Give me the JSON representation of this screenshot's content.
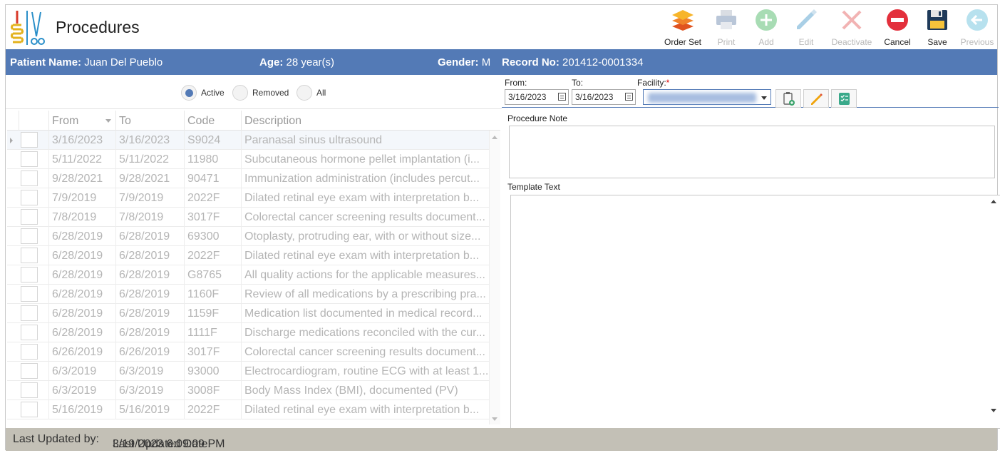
{
  "app": {
    "title": "Procedures"
  },
  "toolbar": {
    "order_set": "Order Set",
    "print": "Print",
    "add": "Add",
    "edit": "Edit",
    "deactivate": "Deactivate",
    "cancel": "Cancel",
    "save": "Save",
    "previous": "Previous"
  },
  "patient": {
    "name_label": "Patient Name:",
    "name": "Juan Del Pueblo",
    "age_label": "Age:",
    "age": "28 year(s)",
    "gender_label": "Gender:",
    "gender": "M",
    "record_label": "Record No:",
    "record": "201412-0001334"
  },
  "filters": {
    "active": "Active",
    "removed": "Removed",
    "all": "All",
    "selected": "Active"
  },
  "grid": {
    "columns": [
      "From",
      "To",
      "Code",
      "Description"
    ],
    "rows": [
      {
        "from": "3/16/2023",
        "to": "3/16/2023",
        "code": "S9024",
        "desc": "Paranasal sinus ultrasound"
      },
      {
        "from": "5/11/2022",
        "to": "5/11/2022",
        "code": "11980",
        "desc": "Subcutaneous hormone pellet implantation (i..."
      },
      {
        "from": "9/28/2021",
        "to": "9/28/2021",
        "code": "90471",
        "desc": "Immunization administration (includes percut..."
      },
      {
        "from": "7/9/2019",
        "to": "7/9/2019",
        "code": "2022F",
        "desc": "Dilated retinal eye exam with interpretation b..."
      },
      {
        "from": "7/8/2019",
        "to": "7/8/2019",
        "code": "3017F",
        "desc": "Colorectal cancer screening results document..."
      },
      {
        "from": "6/28/2019",
        "to": "6/28/2019",
        "code": "69300",
        "desc": "Otoplasty, protruding ear, with or without size..."
      },
      {
        "from": "6/28/2019",
        "to": "6/28/2019",
        "code": "2022F",
        "desc": "Dilated retinal eye exam with interpretation b..."
      },
      {
        "from": "6/28/2019",
        "to": "6/28/2019",
        "code": "G8765",
        "desc": "All quality actions for the applicable measures..."
      },
      {
        "from": "6/28/2019",
        "to": "6/28/2019",
        "code": "1160F",
        "desc": "Review of all medications by a prescribing pra..."
      },
      {
        "from": "6/28/2019",
        "to": "6/28/2019",
        "code": "1159F",
        "desc": "Medication list documented in medical record..."
      },
      {
        "from": "6/28/2019",
        "to": "6/28/2019",
        "code": "1111F",
        "desc": "Discharge medications reconciled with the cur..."
      },
      {
        "from": "6/26/2019",
        "to": "6/26/2019",
        "code": "3017F",
        "desc": "Colorectal cancer screening results document..."
      },
      {
        "from": "6/3/2019",
        "to": "6/3/2019",
        "code": "93000",
        "desc": "Electrocardiogram, routine ECG with at least 1..."
      },
      {
        "from": "6/3/2019",
        "to": "6/3/2019",
        "code": "3008F",
        "desc": "Body Mass Index (BMI), documented (PV)"
      },
      {
        "from": "5/16/2019",
        "to": "5/16/2019",
        "code": "2022F",
        "desc": "Dilated retinal eye exam with interpretation b..."
      }
    ]
  },
  "detail": {
    "from_label": "From:",
    "from_value": "3/16/2023",
    "to_label": "To:",
    "to_value": "3/16/2023",
    "facility_label": "Facility:",
    "facility_required": "*",
    "procedure_note_label": "Procedure Note",
    "procedure_note_value": "",
    "template_text_label": "Template Text",
    "template_text_value": ""
  },
  "footer": {
    "last_updated_by_label": "Last Updated by:",
    "last_updated_date_label": "Last Updated Date:",
    "last_updated_date": "3/19/2023 6:09:09 PM"
  },
  "colors": {
    "accent": "#537ab6",
    "footer": "#c3c0b6",
    "cancel": "#e3303c"
  }
}
